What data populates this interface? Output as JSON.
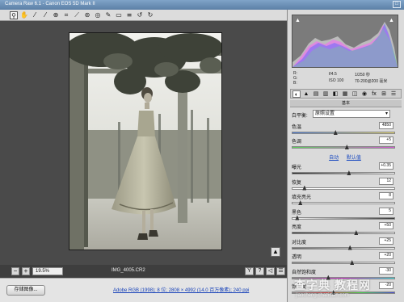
{
  "window": {
    "title": "Camera Raw 6.1 - Canon EOS 5D Mark II",
    "maximize_glyph": "□"
  },
  "toolbar": {
    "tools": [
      {
        "name": "zoom-tool",
        "glyph": "⚲",
        "active": true
      },
      {
        "name": "hand-tool",
        "glyph": "✋"
      },
      {
        "name": "white-balance-tool",
        "glyph": "⁄"
      },
      {
        "name": "color-sampler-tool",
        "glyph": "⁄"
      },
      {
        "name": "targeted-adjustment-tool",
        "glyph": "⊕"
      },
      {
        "name": "crop-tool",
        "glyph": "⌗"
      },
      {
        "name": "straighten-tool",
        "glyph": "⟋"
      },
      {
        "name": "spot-removal-tool",
        "glyph": "⊛"
      },
      {
        "name": "red-eye-tool",
        "glyph": "◎"
      },
      {
        "name": "adjustment-brush-tool",
        "glyph": "✎"
      },
      {
        "name": "graduated-filter-tool",
        "glyph": "▭"
      },
      {
        "name": "preferences-tool",
        "glyph": "≡"
      },
      {
        "name": "rotate-left-tool",
        "glyph": "↺"
      },
      {
        "name": "rotate-right-tool",
        "glyph": "↻"
      }
    ]
  },
  "preview": {
    "zoom_minus": "−",
    "zoom_plus": "+",
    "zoom_level": "19.5%",
    "file_name": "IMG_4005.CR2",
    "expand_glyph": "▲",
    "view_buttons": [
      "Y",
      "?",
      "◁",
      "☰"
    ]
  },
  "bottom": {
    "save_label": "存储图像...",
    "workflow_text": "Adobe RGB (1998); 8 位; 2808 × 4992 (14.0 百万像素); 240 ppi"
  },
  "panel": {
    "histogram": {
      "clip_shadow": "▲",
      "clip_highlight": "▲",
      "colors": {
        "red": "#ff4a4a",
        "green": "#5aff5a",
        "blue": "#6a6aff",
        "magenta": "#ff5aff",
        "white": "#ffffff"
      }
    },
    "readout": {
      "f": "f/4.5",
      "shutter": "1/250 秒",
      "iso": "ISO 100",
      "lens": "70-200@200 毫米",
      "r": "R:",
      "g": "G:",
      "b": "B:"
    },
    "tabs": [
      "◐",
      "▲",
      "▤",
      "▥",
      "◧",
      "▦",
      "◫",
      "◉",
      "fx",
      "⊞",
      "☰"
    ],
    "section_title": "基本",
    "white_balance": {
      "label": "白平衡:",
      "value": "原照设置"
    },
    "auto_links": {
      "auto": "自动",
      "default": "默认值"
    },
    "sliders_top": [
      {
        "name": "temperature",
        "label": "色温",
        "value": "4850",
        "position": 0.42,
        "track": "linear-gradient(90deg,#4a7ad8,#e8d86a)"
      },
      {
        "name": "tint",
        "label": "色调",
        "value": "+5",
        "position": 0.53,
        "track": "linear-gradient(90deg,#5ad85a,#d85ad8)"
      }
    ],
    "sliders_tone": [
      {
        "name": "exposure",
        "label": "曝光",
        "value": "+0.35",
        "position": 0.55,
        "track": "linear-gradient(90deg,#222,#fff)"
      },
      {
        "name": "recovery",
        "label": "恢复",
        "value": "12",
        "position": 0.12,
        "track": "linear-gradient(90deg,#fff,#fff)"
      },
      {
        "name": "fill-light",
        "label": "填充亮光",
        "value": "8",
        "position": 0.08,
        "track": "linear-gradient(90deg,#fff,#fff)"
      },
      {
        "name": "blacks",
        "label": "黑色",
        "value": "5",
        "position": 0.05,
        "track": "linear-gradient(90deg,#fff,#333)"
      },
      {
        "name": "brightness",
        "label": "亮度",
        "value": "+50",
        "position": 0.62,
        "track": "linear-gradient(90deg,#333,#fff)"
      },
      {
        "name": "contrast",
        "label": "对比度",
        "value": "+25",
        "position": 0.56,
        "track": "linear-gradient(90deg,#666,#fff)"
      },
      {
        "name": "clarity",
        "label": "透明",
        "value": "+20",
        "position": 0.58,
        "track": "linear-gradient(90deg,#888,#fff)"
      },
      {
        "name": "vibrance",
        "label": "自然饱和度",
        "value": "-30",
        "position": 0.35,
        "track": "linear-gradient(90deg,#888,#d83ad8,#3ad8d8)"
      },
      {
        "name": "saturation",
        "label": "饱和度",
        "value": "-20",
        "position": 0.4,
        "track": "linear-gradient(90deg,#888,#d84a4a,#4ad84a,#4a4ad8)"
      }
    ]
  },
  "watermark": {
    "main": "查字典 教程网",
    "sub": "jiaocheng.chazidian.com"
  }
}
